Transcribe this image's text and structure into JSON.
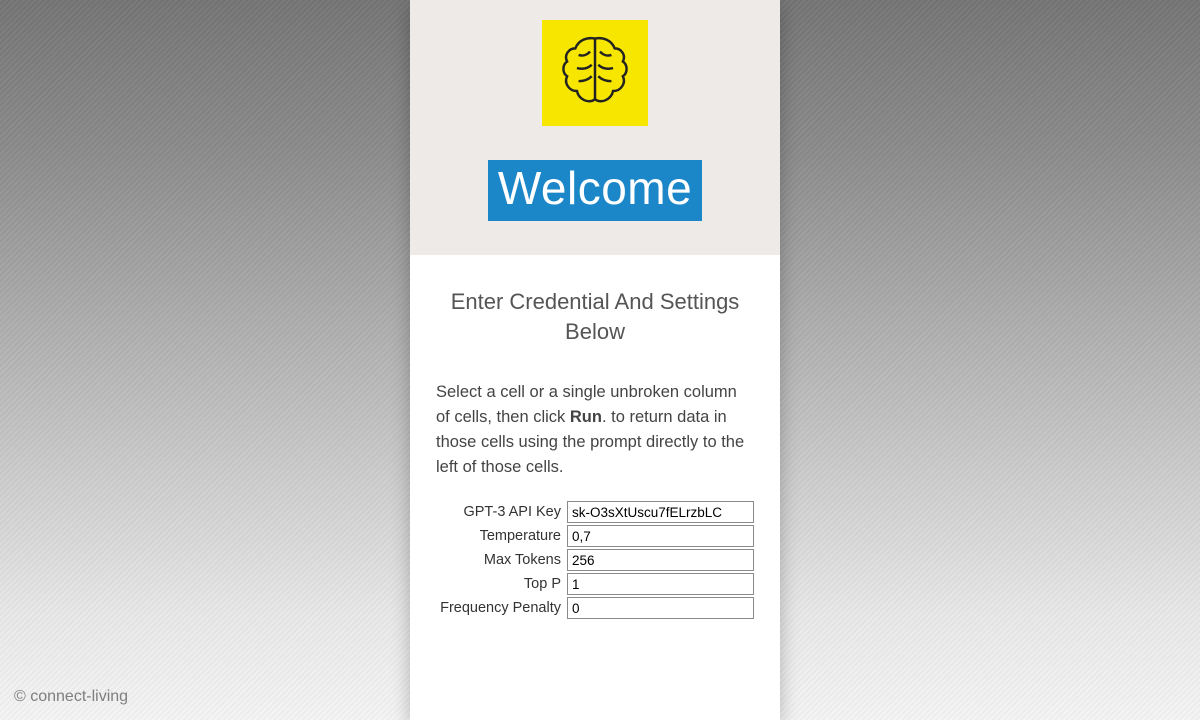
{
  "hero": {
    "title": "Welcome"
  },
  "subtitle": "Enter Credential And Settings Below",
  "instructions": {
    "pre": "Select a cell or a single unbroken column of cells, then click ",
    "bold": "Run",
    "post": ". to return data in those cells using the prompt directly to the left of those cells."
  },
  "fields": {
    "api_key": {
      "label": "GPT-3 API Key",
      "value": "sk-O3sXtUscu7fELrzbLC"
    },
    "temperature": {
      "label": "Temperature",
      "value": "0,7"
    },
    "max_tokens": {
      "label": "Max Tokens",
      "value": "256"
    },
    "top_p": {
      "label": "Top P",
      "value": "1"
    },
    "freq_pen": {
      "label": "Frequency Penalty",
      "value": "0"
    }
  },
  "copyright": "© connect-living"
}
